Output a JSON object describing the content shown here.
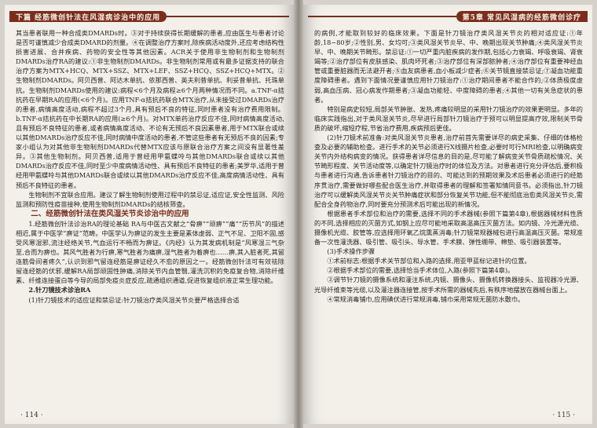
{
  "left_page": {
    "header": "下篇 经筋微创针法在风湿病诊治中的应用",
    "paragraphs": [
      "其当患者联用一种合成类DMARDs时。③对于持续获得长期缓解的患者,应由医生与患者讨论是否可谨慎减少合成类DMARD的剂量。④在调整治疗方案时,除疾病活动度外,还应考虑结构性损害进展、合并疾病、药物的安全性等其他因素。ACR关于使用非生物制剂和生物制剂DMARDs治疗RA的建议:①非生物制剂DMARDs。非生物制剂常用或有最多证据支持的联合治疗方案为MTX+HCQ、MTX+SSZ、MTX+LEF、SSZ+HCQ、SSZ+HCQ+MTX。②生物制剂DMARDs。阿贝西普、阿达木单抗、依那西普、英夫利昔单抗、利妥昔单抗、托珠单抗。生物制剂DMARDs使用的建议:病程<6个月及病程≥6个月两种情况而不同。a.TNF-α拮抗药在早期RA的应用(<6个月)。应用TNF-α拮抗药联合MTX治疗,从未接受过DMARDs治疗的患者,病情高度活动,病程不超过3个月,具有预后不良的特征,同时患者没有治疗费用限制。b.TNF-α拮抗药在中长期RA的应用(≥6个月)。对MTX单药治疗反应不佳,同时病情高度活动,且有预后不良特征的患者,或者病情高度活动、不论有无预后不良因素患者,用于MTX联合或续以其他DMARDs治疗反应不佳,同时病情中度活动的患者,不管这些患者有无预后不良的因素;专家小组认为对其他非生物制剂DMARDs代替MTX应该与原联合治疗方案之间没有显著性差异。③其他生物制剂。阿贝西普,适用于曾经用甲氨蝶呤与其他DMARDs联合或续以其他DMARDs治疗反应不佳,同时至少中度病情活动性、具有预后不良特征的患者;美罗华,适用于曾经用甲氨蝶呤与其他DMARDs联合或续以其他DMARDs治疗反应不佳,高度病情活动性、具有预后不良特征的患者。",
      "生物制剂不宜联合应用。建议了解生物制剂使用过程中的禁忌证,适应证,安全性监测、风险监测和预防性疫苗接种,使用生物制剂DMARDs的结核筛查。"
    ],
    "section_title": "二、经筋微创针法在类风湿关节炎诊治中的应用",
    "section_paragraph": "1.经筋微创针法诊治RA的理论基础 RA与中医古文献之“骨痹”“顽痹”“痛”“历节风”的描述相近,属于中医学“痹证”范畴。中医学认为痹证的发生主要是素体虚弱、正气不足、卫阳不固,感受风寒湿邪,流注经络关节,气血运行不畅而为痹证。《内经》认为其发病机制是“风寒湿三气杂至,合而为痹也。其风气胜者为行痹,寒气胜者为痛痹,湿气胜者为着痹也……痹,其入脏者死,其留连筋骨间者疼久”,认识到邪气留连经筋是痹证经久不愈的原因之一。经筋微创针法可有效祛除留连经筋的伏邪,缓解RA局部顽固性肿痛,消除关节内血管翳,灌洗沉积的免疫复合物,消除纤维素、纤维连接蛋白等今导的局部免疫炎症反应,疏通组织通道,促进恢复组织液正常生理功能。",
    "subheading": "2.针刀镜技术诊治RA",
    "last_paragraph": "(1)针刀镜技术的适应证和禁忌证:针刀镜治疗类风湿关节炎要严格选择合适",
    "folio": "· 114 ·"
  },
  "right_page": {
    "header": "第5章 常见风湿病的经筋微创诊疗",
    "paragraphs": [
      "的病例,才能取到较好的临床效果。下面是针刀镜治疗类风湿关节炎的相对适应证:①年龄,18~80岁;②性别,男、女均可;③类风湿关节炎早、中、晚期出现关节肿痛;④类风湿关节炎早、中、晚期关节畸形。禁忌证:①一切严重内脏疾病的发作期,包括心力衰竭、呼吸衰竭、肾衰竭等;②治疗部位有皮肤感染、肌肉坏死者;③治疗部位有深部脓肿者;④治疗部位有重要神经血管或重要脏器而无法避开者;⑤血友病患者,血小板减少症者;⑥关节镜直接禁忌证;⑦凝血功能重度障碍患者。遇到下面情况要谨慎应用针刀镜治疗:①治疗期间患者不能合作的;②体质极度虚弱,高血压病、冠心病发作期患者;③凝血功能轻、中度障碍的患者;④其他一切有关急症状的患者。",
      "特别是病史较短,局部关节肿胀、发热,疼痛较明显的采用针刀镜治疗的效果更明显。多年的临床实践指出,对于类风湿关节炎,尽早进行局部针刀镜治疗于预可以明显提高疗效,限制关节骨质的破坏,缩短疗程,节省治疗费用,疾病预后更佳。",
      "(2)针刀镜术前准备:对类风湿关节炎患者,治疗前首先需要详尽的病史采集、仔细的体格检查及必要的辅助检查。进行手术的关节必须进行X线摄片检查,必要时可行MRI检查,以明确病变关节内外结构病变的情况。获得患者详尽信息的目的是,尽可能了解病变关节骨质疏松情况、关节畸形程度、关节活动度等,以确定针刀镜治疗时的体位及方法。对患者进行充分评估后,要积极与患者进行沟通,告诉患者针刀镜治疗的目的、可能达到的预期效果及术后患者必须进行的经筋序贯治疗,需要做好哪些配合医生治疗,并取得患者的理解和签署知情同意书。必须指出,针刀镜治疗可以缓解类风湿关节炎关节肿痛症状和部分恢复关节功能,但不能彻底治愈类风湿关节炎,需配合全身药物治疗,同时要充分预测术后可能出现的新情况。",
      "根据患者手术部位和治疗的需要,选择不同的手术器械(参照下篇第4章),根据器械材料性质的不同,选择相应的灭菌方式,如钢上应尽可能地采取高温高压灭菌方法。如内镜、冷光源光缆、摄像机光缆、胶管等,应选择用环氧乙烷熏蒸消毒;针刀镜常规器械包进行高温高压灭菌。常规准备一次性灌洗器、吸引管、吸引头、导水管、手术膜、弹性绷带、棉垫、吸引器装置等。",
      "(3)手术操作步骤",
      "①术前标志:根据手术关节部位和入路的选择,用亚甲蓝标记进针的位置。",
      "②根据手术部位的需要,选择恰当手术体位,入路(参照下篇第4章)。",
      "③调节针刀镜的摄像系统和灌注系统,内镜、摄像头、摄像机转换器接头、监视器冷光源、光导纤维束等光缆,以及灌注器连接管,按手术所需的器械先后,有秩序地摆放在器械台面上。",
      "④常规消毒铺巾,应用碘伏进行常规消毒,铺巾采用常规无菌防水敷巾。"
    ],
    "folio": "· 115 ·"
  }
}
